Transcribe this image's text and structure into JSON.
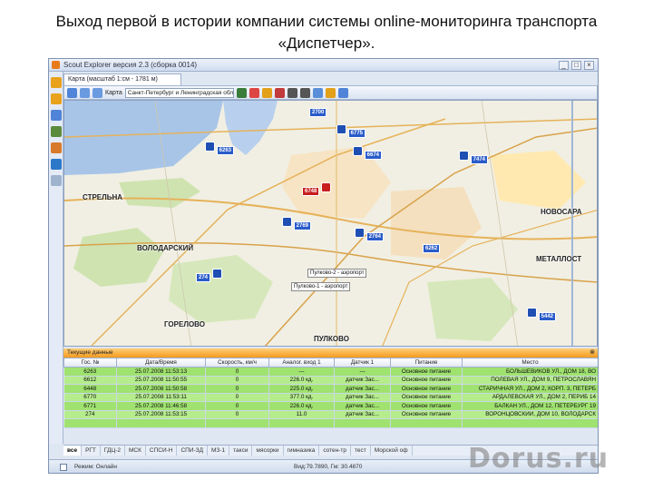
{
  "slide": {
    "title": "Выход первой в истории компании системы online-мониторинга транспорта «Диспетчер»."
  },
  "window": {
    "app_title": "Scout Explorer   версия 2.3 (сборка 0014)",
    "minimize": "_",
    "maximize": "□",
    "close": "×"
  },
  "map_tab": {
    "label": "Карта (масштаб 1:см - 1781 м)"
  },
  "toolbar": {
    "map_label": "Карта",
    "map_select": "Санкт-Петербург и Ленинградская область"
  },
  "map": {
    "places": [
      "СТРЕЛЬНА",
      "ВОЛОДАРСКИЙ",
      "ГОРЕЛОВО",
      "ПУЛКОВО",
      "НОВОСАРА",
      "МЕТАЛЛОСТ"
    ],
    "vehicles": [
      "2700",
      "6775",
      "6263",
      "6674",
      "7474",
      "6748",
      "2769",
      "2764",
      "6262",
      "5442",
      "274"
    ],
    "captions": [
      "Пулково-2 - аэропорт",
      "Пулково-1 - аэропорт"
    ]
  },
  "panel": {
    "title": "Текущие данные",
    "pin": "⊗",
    "columns": [
      "Гос. №",
      "Дата/Время",
      "Скорость, км/ч",
      "Аналог. вход 1",
      "Датчик 1",
      "Питание",
      "Место"
    ],
    "rows": [
      [
        "6263",
        "25.07.2008 11:53:13",
        "0",
        "---",
        "---",
        "Основное питание",
        "БОЛЬШЕВИКОВ УЛ., ДОМ 18, ВО"
      ],
      [
        "6612",
        "25.07.2008 11:50:55",
        "0",
        "226.0 кд.",
        "датчик Зас...",
        "Основное питание",
        "ПОЛЕВАЯ УЛ., ДОМ 9, ПЕТРОСЛАВЯН"
      ],
      [
        "6448",
        "25.07.2008 11:50:58",
        "0",
        "225.0 кд.",
        "датчик Зас...",
        "Основное питание",
        "СТАРИЧНАЯ УЛ., ДОМ 2, КОРП. 3, ПЕТЕРБ"
      ],
      [
        "6770",
        "25.07.2008 11:53:11",
        "0",
        "377.0 кд.",
        "датчик Зас...",
        "Основное питание",
        "АРДАЛЕВСКАЯ УЛ., ДОМ 2, ПЕРИБ 14"
      ],
      [
        "6771",
        "25.07.2008 11:46:58",
        "0",
        "226.0 кд.",
        "датчик Зас...",
        "Основное питание",
        "БАЛКАН УЛ., ДОМ 12, ПЕТЕРБУРГ 19"
      ],
      [
        "274",
        "25.07.2008 11:53:15",
        "0",
        "11.0",
        "датчик Зас...",
        "Основное питание",
        "ВОРОНЦОВСКИЙ, ДОМ 10, ВОЛОДАРСК"
      ],
      [
        "",
        "",
        "",
        "",
        "",
        "",
        ""
      ]
    ]
  },
  "tabs": [
    "все",
    "РГТ",
    "ГДЦ-2",
    "МСК",
    "СПСИ-Н",
    "СПИ-ЗД",
    "МЗ-1",
    "такси",
    "мясорки",
    "гимназика",
    "сотен-тр",
    "тест",
    "Морской оф"
  ],
  "status": {
    "left": "Режим: Онлайн",
    "right": "Вид:79.7890, Гм: 30.4870"
  },
  "watermark": "Dorus.ru",
  "colors": {
    "row_green": "#9fe26f",
    "panel_orange": "#f39a1e",
    "vehicle_blue": "#1f4fb3",
    "vehicle_red": "#c81e1e"
  }
}
